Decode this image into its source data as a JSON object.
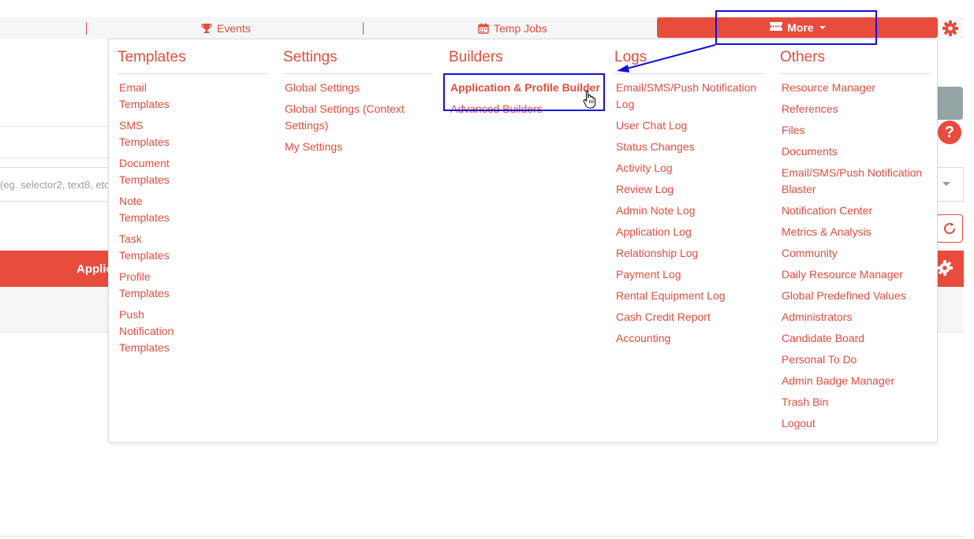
{
  "topnav": {
    "events_label": "Events",
    "events_icon": "trophy-icon",
    "tempjobs_label": "Temp Jobs",
    "tempjobs_icon": "calendar-icon",
    "more_label": "More",
    "more_icon": "ticket-icon",
    "settings_icon": "gear-icon"
  },
  "background": {
    "search_placeholder": "(eg. selector2, text8, etc",
    "red_bar_label": "Applic"
  },
  "menu": {
    "templates": {
      "title": "Templates",
      "items": [
        "Email Templates",
        "SMS Templates",
        "Document Templates",
        "Note Templates",
        "Task Templates",
        "Profile Templates",
        "Push Notification Templates"
      ]
    },
    "settings": {
      "title": "Settings",
      "items": [
        "Global Settings",
        "Global Settings (Context Settings)",
        "My Settings"
      ]
    },
    "builders": {
      "title": "Builders",
      "items": [
        "Application & Profile Builder",
        "Advanced Builders"
      ]
    },
    "logs": {
      "title": "Logs",
      "items": [
        "Email/SMS/Push Notification Log",
        "User Chat Log",
        "Status Changes",
        "Activity Log",
        "Review Log",
        "Admin Note Log",
        "Application Log",
        "Relationship Log",
        "Payment Log",
        "Rental Equipment Log",
        "Cash Credit Report",
        "Accounting"
      ]
    },
    "others": {
      "title": "Others",
      "items": [
        "Resource Manager",
        "References",
        "Files",
        "Documents",
        "Email/SMS/Push Notification Blaster",
        "Notification Center",
        "Metrics & Analysis",
        "Community",
        "Daily Resource Manager",
        "Global Predefined Values",
        "Administrators",
        "Candidate Board",
        "Personal To Do",
        "Admin Badge Manager",
        "Trash Bin",
        "Logout"
      ]
    }
  },
  "colors": {
    "accent": "#e74c3c",
    "annotation": "#1010e0",
    "nav_bg": "#f5f6f8"
  }
}
